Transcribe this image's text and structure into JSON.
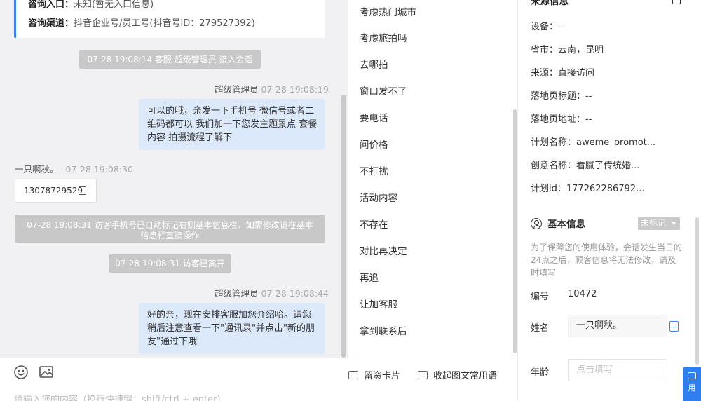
{
  "chat": {
    "info_card": {
      "entry_label": "咨询入口：",
      "entry_value": "未知(暂无入口信息)",
      "channel_label": "咨询渠道：",
      "channel_value": "抖音企业号/员工号(抖音号ID：279527392)"
    },
    "messages": {
      "sys1": "07-28 19:08:14 客服 超级管理员 接入会话",
      "agent1_name": "超级管理员",
      "agent1_time": "07-28 19:08:19",
      "agent1_text": "可以的哦，亲发一下手机号 微信号或者二维码都可以 我们加一下您发主题景点 套餐内容 拍摄流程了解下",
      "visitor_name": "一只啊秋。",
      "visitor_time": "07-28 19:08:30",
      "visitor_phone": "13078729529",
      "sys2": "07-28 19:08:31 访客手机号已自动标记右侧基本信息栏，如需修改请在基本信息栏直接操作",
      "sys3": "07-28 19:08:31 访客已离开",
      "agent2_name": "超级管理员",
      "agent2_time": "07-28 19:08:44",
      "agent2_text": "好的亲，现在安排客服加您介绍哈。请您稍后注意查看一下\"通讯录\"并点击\"新的朋友\"通过下哦"
    }
  },
  "toolbar": {
    "emoji_icon": "smile-icon",
    "image_icon": "image-icon",
    "card_label": "留资卡片",
    "quick_reply_label": "收起图文常用语",
    "placeholder": "请输入您的内容（换行快捷键：shift/ctrl + enter）"
  },
  "quick_replies": [
    "考虑热门城市",
    "考虑旅拍吗",
    "去哪拍",
    "窗口发不了",
    "要电话",
    "问价格",
    "不打扰",
    "活动内容",
    "不存在",
    "对比再决定",
    "再追",
    "让加客服",
    "拿到联系后"
  ],
  "source_info": {
    "title": "来源信息",
    "device_label": "设备：",
    "device_value": "--",
    "city_label": "省市：",
    "city_value": "云南，昆明",
    "source_label": "来源：",
    "source_value": "直接访问",
    "landing_title_label": "落地页标题：",
    "landing_title_value": "--",
    "landing_url_label": "落地页地址：",
    "landing_url_value": "--",
    "plan_name_label": "计划名称：",
    "plan_name_value": "aweme_promot...",
    "creative_label": "创意名称：",
    "creative_value": "看腻了传统婚...",
    "plan_id_label": "计划id：",
    "plan_id_value": "177262286792..."
  },
  "basic_info": {
    "title": "基本信息",
    "tag_select": "未标记",
    "notice": "为了保障您的使用体验，会话发生当日的24点之后，顾客信息将无法修改，请及时填写",
    "id_label": "编号",
    "id_value": "10472",
    "name_label": "姓名",
    "name_value": "一只啊秋。",
    "age_label": "年龄",
    "age_placeholder": "点击填写"
  },
  "float_button": {
    "label": "用"
  }
}
